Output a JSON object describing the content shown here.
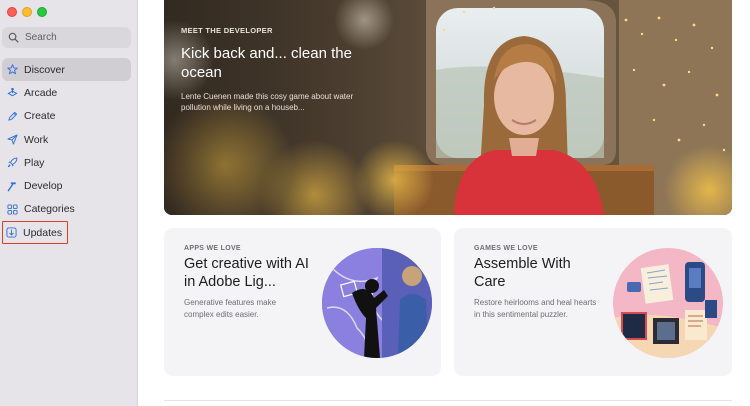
{
  "window": {
    "controls": [
      "close",
      "minimize",
      "zoom"
    ]
  },
  "sidebar": {
    "search": {
      "placeholder": "Search",
      "icon": "search-icon"
    },
    "items": [
      {
        "label": "Discover",
        "icon": "star-icon",
        "active": true
      },
      {
        "label": "Arcade",
        "icon": "arcade-icon"
      },
      {
        "label": "Create",
        "icon": "create-icon"
      },
      {
        "label": "Work",
        "icon": "paperplane-icon"
      },
      {
        "label": "Play",
        "icon": "rocket-icon"
      },
      {
        "label": "Develop",
        "icon": "hammer-icon"
      },
      {
        "label": "Categories",
        "icon": "grid-icon"
      },
      {
        "label": "Updates",
        "icon": "updates-icon",
        "highlighted": true
      }
    ]
  },
  "hero": {
    "eyebrow": "MEET THE DEVELOPER",
    "title": "Kick back and... clean the ocean",
    "subtitle": "Lente Cuenen made this cosy game about water pollution while living on a houseb..."
  },
  "cards": [
    {
      "eyebrow": "APPS WE LOVE",
      "title": "Get creative with AI in Adobe Lig...",
      "subtitle": "Generative features make complex edits easier."
    },
    {
      "eyebrow": "GAMES WE LOVE",
      "title": "Assemble With Care",
      "subtitle": "Restore heirlooms and heal hearts in this sentimental puzzler."
    }
  ],
  "colors": {
    "sidebar_bg": "#e6e4e8",
    "accent": "#2f6fd6",
    "highlight_border": "#d9402b",
    "card_bg": "#f4f4f6"
  }
}
